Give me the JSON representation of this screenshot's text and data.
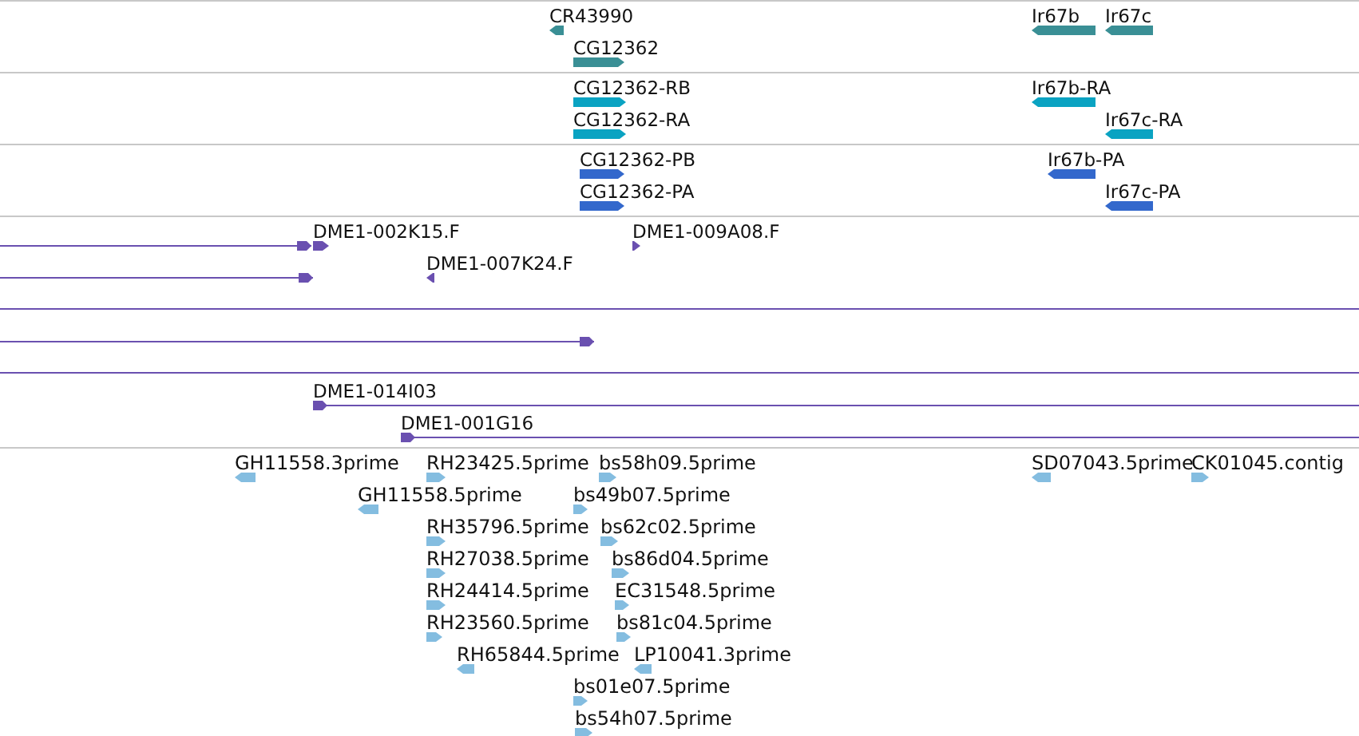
{
  "tracks": [
    {
      "kind": "gene",
      "color": "#3a8f95",
      "features": [
        {
          "label": "CR43990",
          "reverse": true
        },
        {
          "label": "CG12362",
          "reverse": false
        },
        {
          "label": "Ir67b",
          "reverse": true
        },
        {
          "label": "Ir67c",
          "reverse": true
        }
      ]
    },
    {
      "kind": "transcript",
      "color": "#0aa3c2",
      "features": [
        {
          "label": "CG12362-RB",
          "reverse": false
        },
        {
          "label": "CG12362-RA",
          "reverse": false
        },
        {
          "label": "Ir67b-RA",
          "reverse": true
        },
        {
          "label": "Ir67c-RA",
          "reverse": true
        }
      ]
    },
    {
      "kind": "protein",
      "color": "#3368cc",
      "features": [
        {
          "label": "CG12362-PB",
          "reverse": false
        },
        {
          "label": "CG12362-PA",
          "reverse": false
        },
        {
          "label": "Ir67b-PA",
          "reverse": true
        },
        {
          "label": "Ir67c-PA",
          "reverse": true
        }
      ]
    },
    {
      "kind": "clone",
      "color": "#6a50b0",
      "features": [
        {
          "kind": "line",
          "reverse": false
        },
        {
          "kind": "arrow",
          "label": "DME1-002K15.F",
          "reverse": false
        },
        {
          "kind": "arrow",
          "label": "DME1-009A08.F",
          "reverse": false
        },
        {
          "kind": "line",
          "reverse": false
        },
        {
          "kind": "arrow",
          "label": "DME1-007K24.F",
          "reverse": true
        },
        {
          "kind": "plain"
        },
        {
          "kind": "line",
          "reverse": false
        },
        {
          "kind": "plain"
        },
        {
          "kind": "line",
          "label": "DME1-014I03",
          "reverse": false
        },
        {
          "kind": "line",
          "label": "DME1-001G16",
          "reverse": false
        }
      ]
    },
    {
      "kind": "est",
      "color": "#84bde0",
      "features": [
        {
          "label": "GH11558.3prime",
          "reverse": true
        },
        {
          "label": "RH23425.5prime",
          "reverse": false
        },
        {
          "label": "bs58h09.5prime",
          "reverse": false
        },
        {
          "label": "SD07043.5prime",
          "reverse": true
        },
        {
          "label": "CK01045.contig",
          "reverse": false
        },
        {
          "label": "GH11558.5prime",
          "reverse": true
        },
        {
          "label": "bs49b07.5prime",
          "reverse": false
        },
        {
          "label": "RH35796.5prime",
          "reverse": false
        },
        {
          "label": "bs62c02.5prime",
          "reverse": false
        },
        {
          "label": "RH27038.5prime",
          "reverse": false
        },
        {
          "label": "bs86d04.5prime",
          "reverse": false
        },
        {
          "label": "RH24414.5prime",
          "reverse": false
        },
        {
          "label": "EC31548.5prime",
          "reverse": false
        },
        {
          "label": "RH23560.5prime",
          "reverse": false
        },
        {
          "label": "bs81c04.5prime",
          "reverse": false
        },
        {
          "label": "RH65844.5prime",
          "reverse": true
        },
        {
          "label": "LP10041.3prime",
          "reverse": true
        },
        {
          "label": "bs01e07.5prime",
          "reverse": false
        },
        {
          "label": "bs54h07.5prime",
          "reverse": false
        }
      ]
    }
  ]
}
